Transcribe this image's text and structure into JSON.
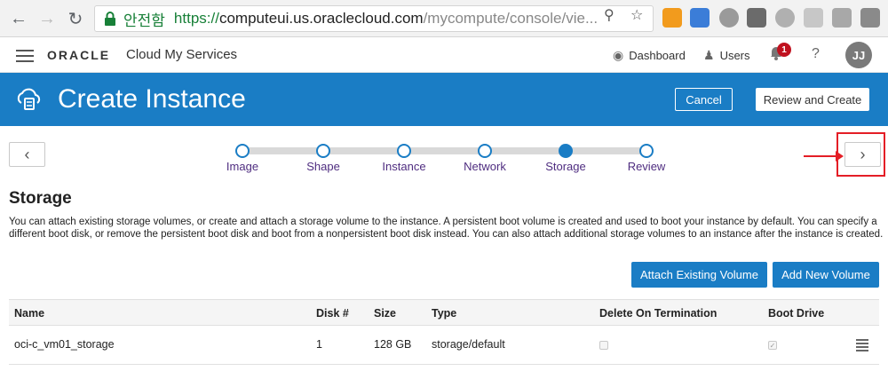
{
  "browser": {
    "secure_label": "안전함",
    "url_scheme": "https://",
    "url_host": "computeui.us.oraclecloud.com",
    "url_path": "/mycompute/console/vie..."
  },
  "header": {
    "brand": "ORACLE",
    "service": "Cloud My Services",
    "dashboard": "Dashboard",
    "users": "Users",
    "notification_count": "1",
    "help": "?",
    "avatar_initials": "JJ"
  },
  "titlebar": {
    "title": "Create Instance",
    "cancel": "Cancel",
    "review": "Review and Create"
  },
  "wizard": {
    "steps": [
      "Image",
      "Shape",
      "Instance",
      "Network",
      "Storage",
      "Review"
    ],
    "current_step": "Storage"
  },
  "section": {
    "title": "Storage",
    "description": "You can attach existing storage volumes, or create and attach a storage volume to the instance. A persistent boot volume is created and used to boot your instance by default. You can specify a different boot disk, or remove the persistent boot disk and boot from a nonpersistent boot disk instead. You can also attach additional storage volumes to an instance after the instance is created.",
    "attach_button": "Attach Existing Volume",
    "add_button": "Add New Volume"
  },
  "table": {
    "columns": [
      "Name",
      "Disk #",
      "Size",
      "Type",
      "Delete On Termination",
      "Boot Drive"
    ],
    "rows": [
      {
        "name": "oci-c_vm01_storage",
        "disk": "1",
        "size": "128 GB",
        "type": "storage/default",
        "delete_on_termination": false,
        "boot_drive": true
      }
    ]
  },
  "colors": {
    "accent": "#1a7dc5",
    "highlight": "#e41e26",
    "step_label": "#4f2d80"
  }
}
